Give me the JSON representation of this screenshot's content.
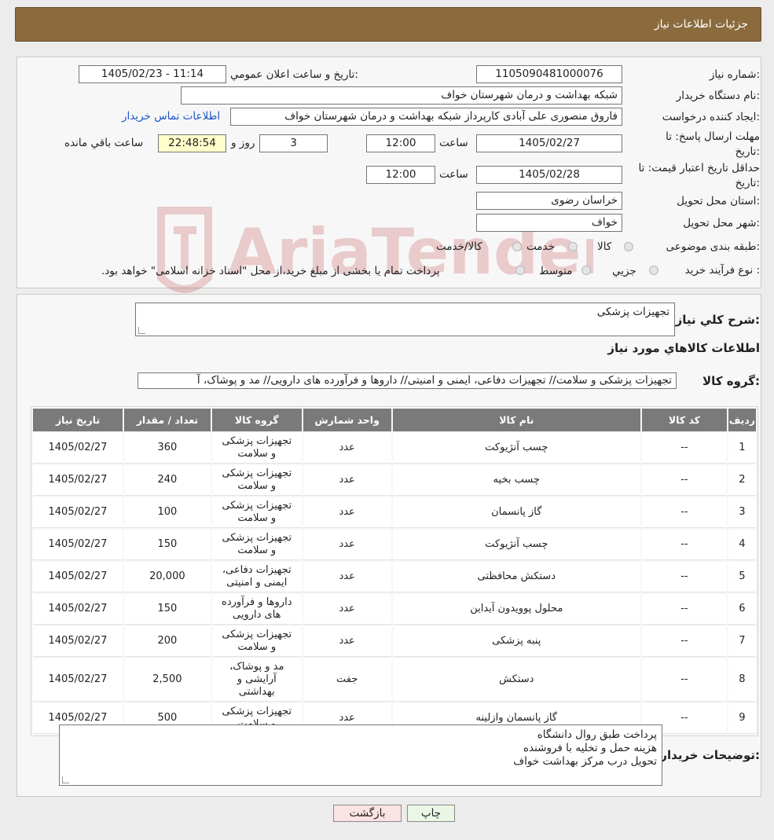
{
  "header": {
    "title": "جزئیات اطلاعات نیاز"
  },
  "form": {
    "need_number_label": "شماره نیاز:",
    "need_number": "1105090481000076",
    "announce_label": "تاريخ و ساعت اعلان عمومي:",
    "announce_value": "1405/02/23 - 11:14",
    "buyer_org_label": "نام دستگاه خريدار:",
    "buyer_org": "شبکه بهداشت و درمان شهرستان خواف",
    "creator_label": "ايجاد کننده درخواست:",
    "creator": "فاروق منصوری علی آبادی کارپرداز شبکه بهداشت و درمان شهرستان خواف",
    "contact_link": "اطلاعات تماس خريدار",
    "deadline_label": "مهلت ارسال پاسخ: تا تاريخ:",
    "deadline_date": "1405/02/27",
    "time_label": "ساعت",
    "deadline_time": "12:00",
    "days_value": "3",
    "days_label": "روز و",
    "remaining_time": "22:48:54",
    "remaining_label": "ساعت باقي مانده",
    "validity_label": "حداقل تاريخ اعتبار قيمت: تا تاريخ:",
    "validity_date": "1405/02/28",
    "validity_time": "12:00",
    "province_label": "استان محل تحويل:",
    "province": "خراسان رضوی",
    "city_label": "شهر محل تحويل:",
    "city": "خواف",
    "category_label": "طبقه بندی موضوعی:",
    "category_options": [
      "کالا",
      "خدمت",
      "کالا/خدمت"
    ],
    "process_label": "نوع فرآيند خريد :",
    "process_options": [
      "جزيي",
      "متوسط"
    ],
    "process_note": "پرداخت تمام یا بخشی از مبلغ خرید،از محل \"اسناد خزانه اسلامی\" خواهد بود."
  },
  "summary": {
    "desc_label": "شرح کلي نياز:",
    "desc_value": "تجهیزات پزشکی",
    "goods_heading": "اطلاعات کالاهاي مورد نياز",
    "group_label": "گروه کالا:",
    "group_value": "تجهیزات پزشکی و سلامت// تجهیزات دفاعی، ایمنی و امنیتی// داروها و فرآورده های دارویی// مد و پوشاک، آ"
  },
  "table": {
    "headers": [
      "رديف",
      "کد کالا",
      "نام کالا",
      "واحد شمارش",
      "گروه کالا",
      "تعداد / مقدار",
      "تاريخ نياز"
    ],
    "rows": [
      {
        "idx": "1",
        "code": "--",
        "name": "چسب آنژیوکت",
        "unit": "عدد",
        "group": "تجهیزات پزشکی و سلامت",
        "qty": "360",
        "date": "1405/02/27"
      },
      {
        "idx": "2",
        "code": "--",
        "name": "چسب بخیه",
        "unit": "عدد",
        "group": "تجهیزات پزشکی و سلامت",
        "qty": "240",
        "date": "1405/02/27"
      },
      {
        "idx": "3",
        "code": "--",
        "name": "گاز پانسمان",
        "unit": "عدد",
        "group": "تجهیزات پزشکی و سلامت",
        "qty": "100",
        "date": "1405/02/27"
      },
      {
        "idx": "4",
        "code": "--",
        "name": "چسب آنژیوکت",
        "unit": "عدد",
        "group": "تجهیزات پزشکی و سلامت",
        "qty": "150",
        "date": "1405/02/27"
      },
      {
        "idx": "5",
        "code": "--",
        "name": "دستکش محافظتی",
        "unit": "عدد",
        "group": "تجهیزات دفاعی، ایمنی و امنیتی",
        "qty": "20,000",
        "date": "1405/02/27"
      },
      {
        "idx": "6",
        "code": "--",
        "name": "محلول پوویدون آیداین",
        "unit": "عدد",
        "group": "داروها و فرآورده های دارویی",
        "qty": "150",
        "date": "1405/02/27"
      },
      {
        "idx": "7",
        "code": "--",
        "name": "پنبه پزشکی",
        "unit": "عدد",
        "group": "تجهیزات پزشکی و سلامت",
        "qty": "200",
        "date": "1405/02/27"
      },
      {
        "idx": "8",
        "code": "--",
        "name": "دستکش",
        "unit": "جفت",
        "group": "مد و پوشاک، آرایشی و بهداشتی",
        "qty": "2,500",
        "date": "1405/02/27"
      },
      {
        "idx": "9",
        "code": "--",
        "name": "گاز پانسمان وازلینه",
        "unit": "عدد",
        "group": "تجهیزات پزشکی و سلامت",
        "qty": "500",
        "date": "1405/02/27"
      }
    ]
  },
  "notes": {
    "label": "توضيحات خريدار:",
    "lines": [
      "پرداخت طبق روال دانشگاه",
      "هزینه حمل و تخلیه با فروشنده",
      "تحویل درب مرکز بهداشت خواف"
    ]
  },
  "buttons": {
    "print": "چاپ",
    "back": "بازگشت"
  },
  "watermark": {
    "text": "AriaTender.neT"
  },
  "colors": {
    "header_bg": "#8b6b3d",
    "table_header_bg": "#7a7a7a",
    "link": "#1a55c8",
    "print_btn": "#eaf7e4",
    "back_btn": "#fbe3e3"
  }
}
